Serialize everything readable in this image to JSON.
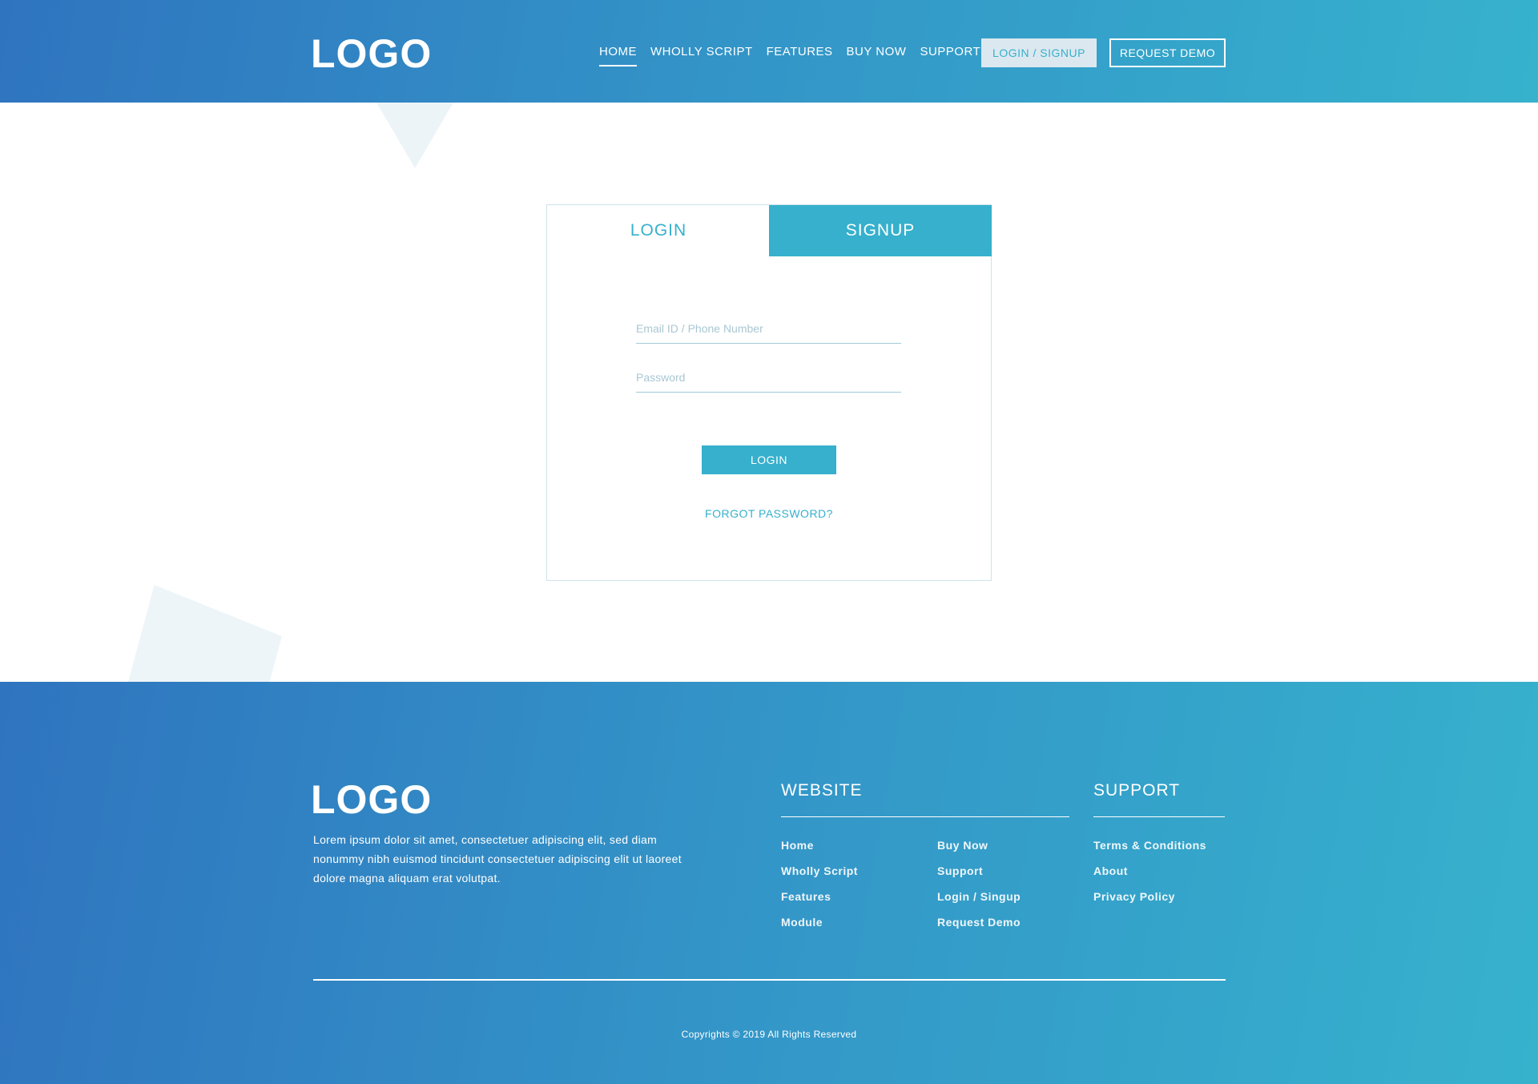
{
  "header": {
    "logo": "LOGO",
    "nav": [
      "HOME",
      "WHOLLY SCRIPT",
      "FEATURES",
      "BUY NOW",
      "SUPPORT"
    ],
    "active_nav": "HOME",
    "login_signup": "LOGIN / SIGNUP",
    "request_demo": "REQUEST DEMO"
  },
  "auth": {
    "tab_login": "LOGIN",
    "tab_signup": "SIGNUP",
    "active_tab": "SIGNUP",
    "email_placeholder": "Email ID / Phone Number",
    "password_placeholder": "Password",
    "submit": "LOGIN",
    "forgot": "FORGOT PASSWORD?"
  },
  "footer": {
    "logo": "LOGO",
    "description": "Lorem ipsum dolor sit amet, consectetuer adipiscing elit, sed diam nonummy nibh euismod tincidunt consectetuer adipiscing elit ut laoreet dolore magna aliquam erat volutpat.",
    "website_title": "WEBSITE",
    "website_col1": [
      "Home",
      "Wholly Script",
      "Features",
      "Module"
    ],
    "website_col2": [
      "Buy Now",
      "Support",
      "Login / Singup",
      "Request Demo"
    ],
    "support_title": "SUPPORT",
    "support_links": [
      "Terms & Conditions",
      "About",
      "Privacy Policy"
    ],
    "copyright": "Copyrights © 2019 All Rights Reserved"
  },
  "colors": {
    "accent": "#36b0cc",
    "gradient_start": "#2f74bf",
    "gradient_end": "#36b2cd"
  }
}
